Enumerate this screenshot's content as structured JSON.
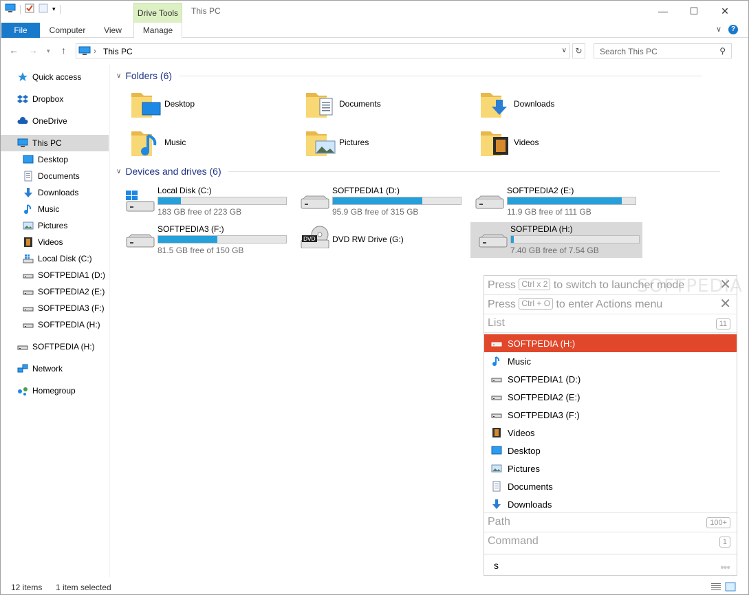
{
  "window": {
    "title": "This PC",
    "context_tab": "Drive Tools"
  },
  "ribbon": {
    "tabs": [
      "File",
      "Computer",
      "View",
      "Manage"
    ]
  },
  "address": {
    "location": "This PC",
    "search_placeholder": "Search This PC"
  },
  "nav": {
    "items": [
      {
        "label": "Quick access",
        "icon": "star-icon"
      },
      {
        "label": "Dropbox",
        "icon": "dropbox-icon"
      },
      {
        "label": "OneDrive",
        "icon": "cloud-icon"
      },
      {
        "label": "This PC",
        "icon": "computer-icon"
      },
      {
        "label": "Desktop",
        "icon": "desktop-icon"
      },
      {
        "label": "Documents",
        "icon": "documents-icon"
      },
      {
        "label": "Downloads",
        "icon": "download-icon"
      },
      {
        "label": "Music",
        "icon": "music-icon"
      },
      {
        "label": "Pictures",
        "icon": "pictures-icon"
      },
      {
        "label": "Videos",
        "icon": "videos-icon"
      },
      {
        "label": "Local Disk (C:)",
        "icon": "local-disk-icon"
      },
      {
        "label": "SOFTPEDIA1 (D:)",
        "icon": "drive-icon"
      },
      {
        "label": "SOFTPEDIA2 (E:)",
        "icon": "drive-icon"
      },
      {
        "label": "SOFTPEDIA3 (F:)",
        "icon": "drive-icon"
      },
      {
        "label": "SOFTPEDIA (H:)",
        "icon": "drive-icon"
      },
      {
        "label": "SOFTPEDIA (H:)",
        "icon": "drive-icon"
      },
      {
        "label": "Network",
        "icon": "network-icon"
      },
      {
        "label": "Homegroup",
        "icon": "homegroup-icon"
      }
    ]
  },
  "folders": {
    "header": "Folders (6)",
    "items": [
      "Desktop",
      "Documents",
      "Downloads",
      "Music",
      "Pictures",
      "Videos"
    ]
  },
  "drives": {
    "header": "Devices and drives (6)",
    "items": [
      {
        "name": "Local Disk (C:)",
        "free": "183 GB free of 223 GB",
        "used_fraction": 0.18
      },
      {
        "name": "SOFTPEDIA1 (D:)",
        "free": "95.9 GB free of 315 GB",
        "used_fraction": 0.7
      },
      {
        "name": "SOFTPEDIA2 (E:)",
        "free": "11.9 GB free of 111 GB",
        "used_fraction": 0.89
      },
      {
        "name": "SOFTPEDIA3 (F:)",
        "free": "81.5 GB free of 150 GB",
        "used_fraction": 0.46
      },
      {
        "name": "DVD RW Drive (G:)",
        "free": "",
        "used_fraction": null
      },
      {
        "name": "SOFTPEDIA (H:)",
        "free": "7.40 GB free of 7.54 GB",
        "used_fraction": 0.02
      }
    ]
  },
  "launcher": {
    "hint1": {
      "pre": "Press",
      "key": "Ctrl x 2",
      "post": "to switch to launcher mode"
    },
    "hint2": {
      "pre": "Press",
      "key": "Ctrl + O",
      "post": "to enter Actions menu"
    },
    "list_label": "List",
    "list_count": "11",
    "items": [
      "SOFTPEDIA (H:)",
      "Music",
      "SOFTPEDIA1 (D:)",
      "SOFTPEDIA2 (E:)",
      "SOFTPEDIA3 (F:)",
      "Videos",
      "Desktop",
      "Pictures",
      "Documents",
      "Downloads"
    ],
    "path_label": "Path",
    "path_count": "100+",
    "command_label": "Command",
    "command_count": "1",
    "query": "s",
    "watermark": "SOFTPEDIA"
  },
  "status": {
    "items": "12 items",
    "selected": "1 item selected"
  }
}
